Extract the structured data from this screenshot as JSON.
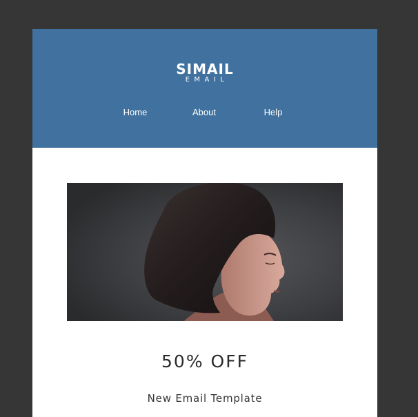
{
  "header": {
    "logo_main": "SIMAIL",
    "logo_sub": "EMAIL",
    "nav": [
      "Home",
      "About",
      "Help"
    ]
  },
  "hero": {
    "image": "woman-profile-photo"
  },
  "content": {
    "headline": "50% OFF",
    "subheadline": "New Email Template"
  },
  "colors": {
    "page_background": "#363636",
    "header_background": "#41729f",
    "card_background": "#ffffff",
    "text_dark": "#2b2b2b"
  }
}
